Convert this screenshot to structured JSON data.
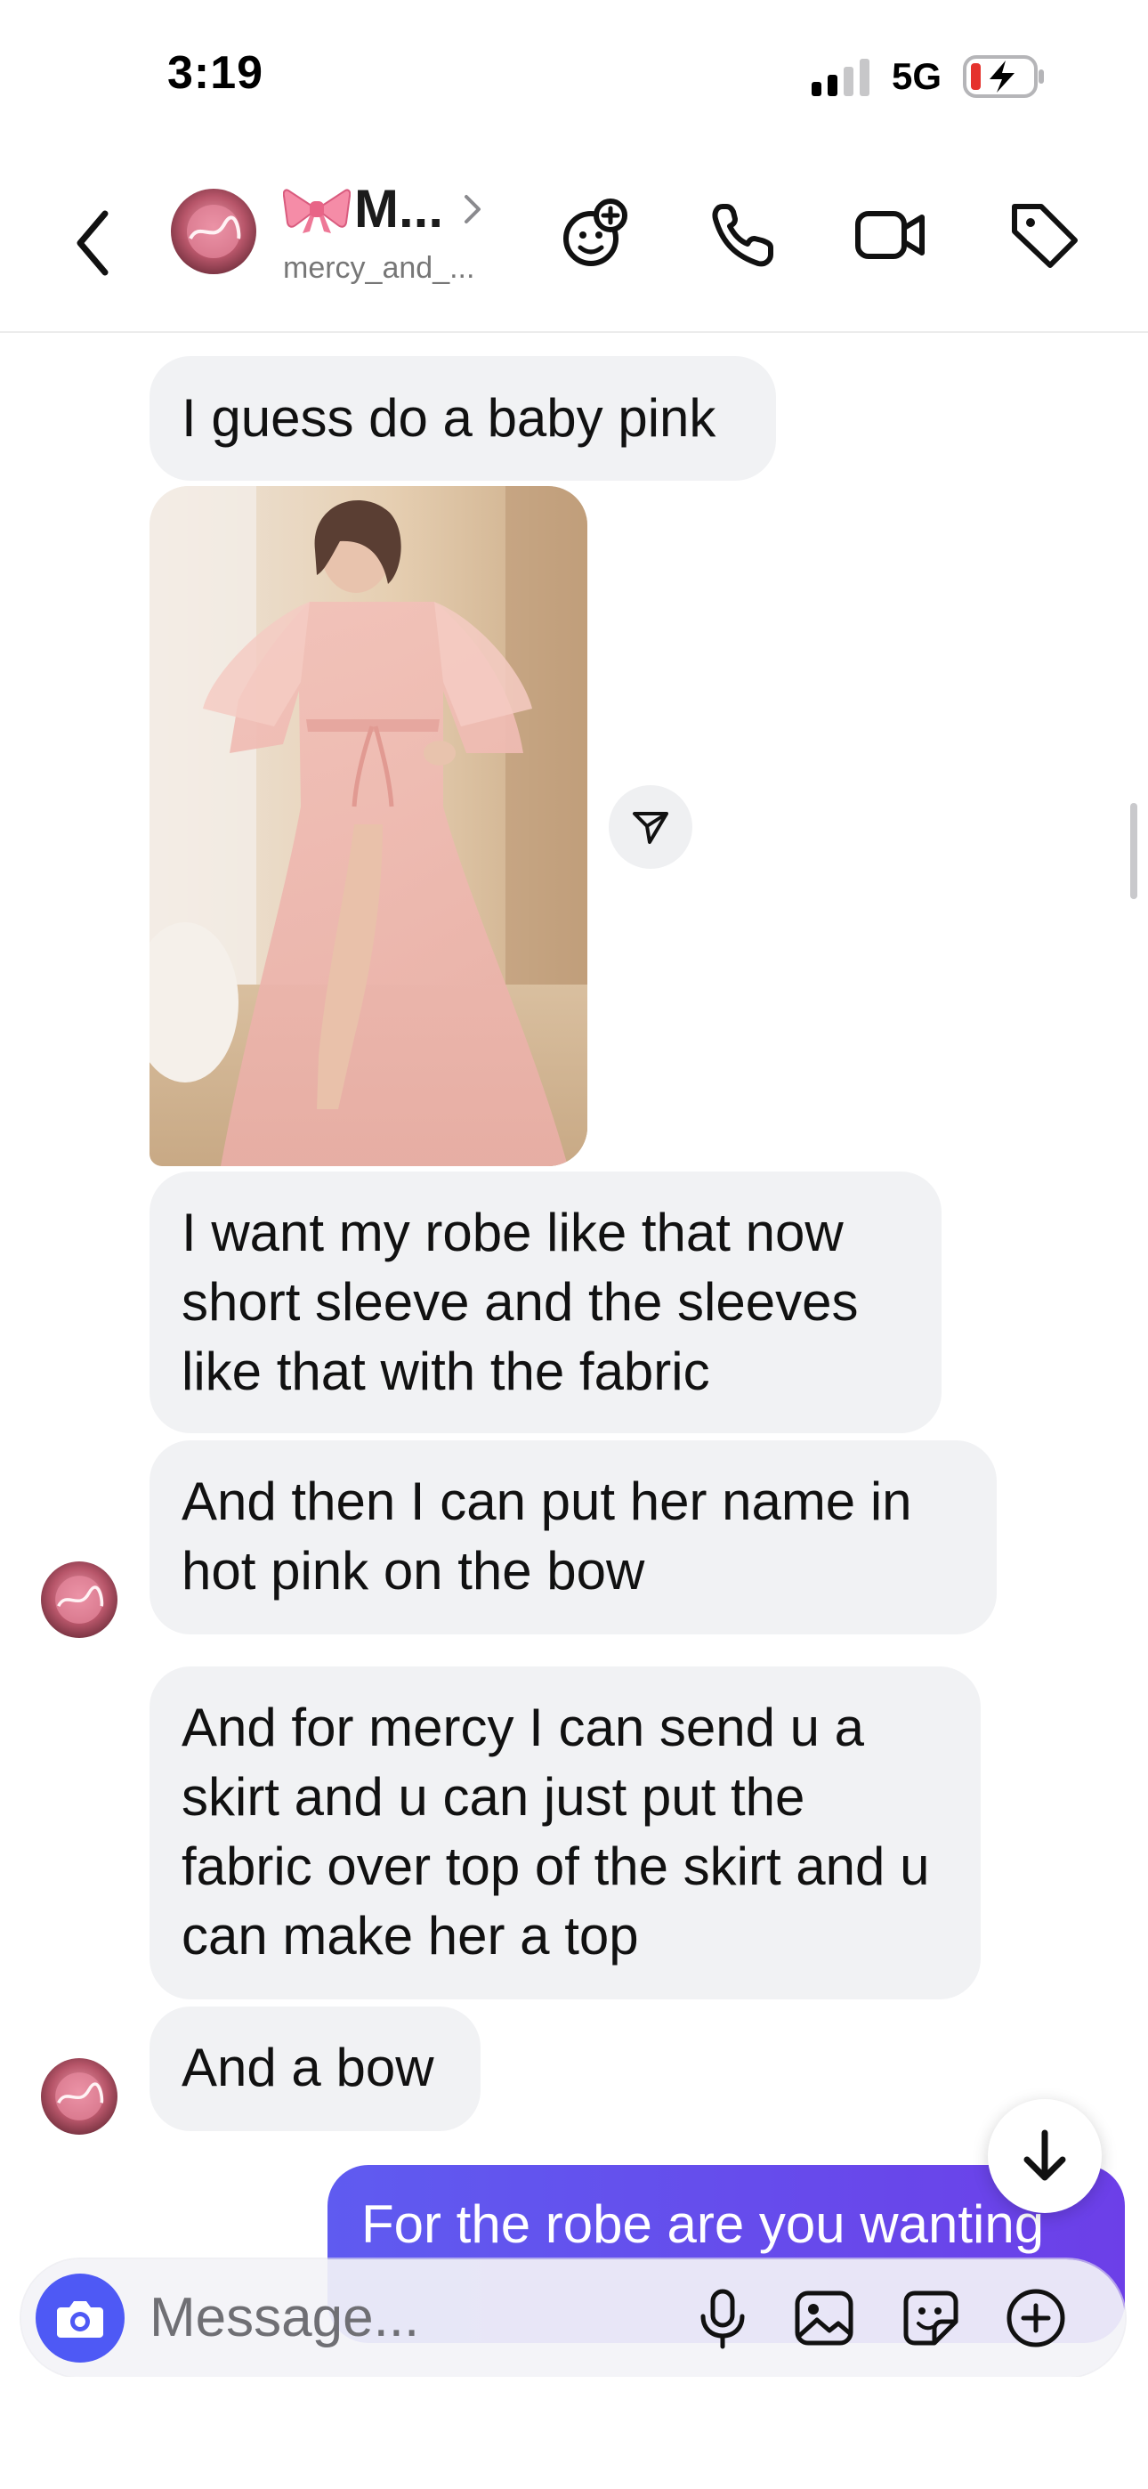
{
  "status_bar": {
    "time": "3:19",
    "network": "5G"
  },
  "header": {
    "name": "M...",
    "handle": "mercy_and_..."
  },
  "messages": [
    {
      "text": "I guess do a baby pink",
      "direction": "incoming"
    },
    {
      "text": "I want my robe like that now short sleeve and the sleeves like that with the fabric",
      "direction": "incoming"
    },
    {
      "text": "And then I can put her name in hot pink on the bow",
      "direction": "incoming"
    },
    {
      "text": "And for mercy I can send u a skirt and u can just put the fabric over top of the skirt and u can make her a top",
      "direction": "incoming"
    },
    {
      "text": "And a bow",
      "direction": "incoming"
    },
    {
      "text": "For the robe are you wanting",
      "direction": "outgoing"
    }
  ],
  "composer": {
    "placeholder": "Message..."
  },
  "icons": {
    "back": "chevron-left-icon",
    "header_actions": [
      "add-friend-icon",
      "phone-icon",
      "video-icon",
      "tag-icon"
    ],
    "composer_actions": [
      "camera-icon",
      "microphone-icon",
      "gallery-icon",
      "sticker-icon",
      "plus-icon"
    ]
  },
  "colors": {
    "accent": "#4e59f5",
    "outgoing_bubble": "#6248ec",
    "incoming_bubble": "#f1f2f4"
  }
}
